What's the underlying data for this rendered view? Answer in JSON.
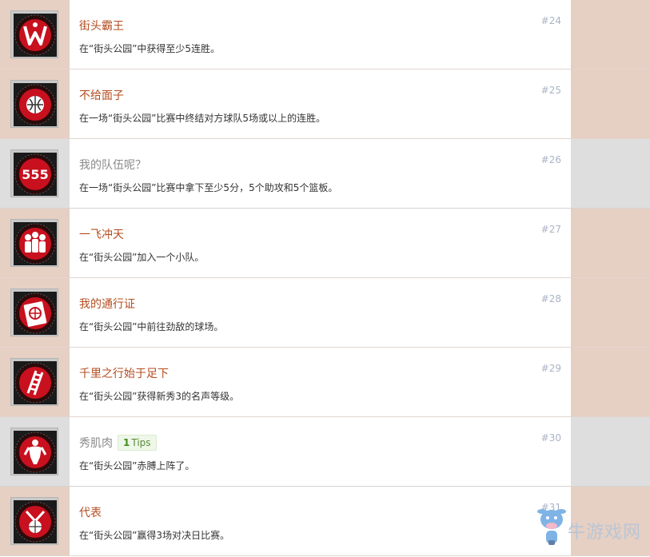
{
  "achievements": [
    {
      "title": "街头霸王",
      "description": "在“街头公园”中获得至少5连胜。",
      "number": "#24",
      "state": "unlocked",
      "icon": "wrestler-w-icon"
    },
    {
      "title": "不给面子",
      "description": "在一场“街头公园”比赛中终结对方球队5场或以上的连胜。",
      "number": "#25",
      "state": "unlocked",
      "icon": "broken-ball-icon"
    },
    {
      "title": "我的队伍呢？",
      "description": "在一场“街头公园”比赛中拿下至少5分，5个助攻和5个篮板。",
      "number": "#26",
      "state": "locked",
      "icon": "triple-five-icon"
    },
    {
      "title": "一飞冲天",
      "description": "在“街头公园”加入一个小队。",
      "number": "#27",
      "state": "unlocked",
      "icon": "three-players-icon"
    },
    {
      "title": "我的通行证",
      "description": "在“街头公园”中前往劲敌的球场。",
      "number": "#28",
      "state": "unlocked",
      "icon": "globe-pass-icon"
    },
    {
      "title": "千里之行始于足下",
      "description": "在“街头公园”获得新秀3的名声等级。",
      "number": "#29",
      "state": "unlocked",
      "icon": "ladder-icon"
    },
    {
      "title": "秀肌肉",
      "description": "在“街头公园”赤膊上阵了。",
      "number": "#30",
      "state": "locked",
      "icon": "muscle-man-icon",
      "tips": {
        "count": "1",
        "label": "Tips"
      }
    },
    {
      "title": "代表",
      "description": "在“街头公园”赢得3场对决日比赛。",
      "number": "#31",
      "state": "unlocked",
      "icon": "ball-trophy-icon"
    }
  ],
  "watermark": {
    "text": "牛游戏网",
    "icon": "cow-mascot-icon"
  },
  "colors": {
    "title_unlocked": "#b34d1f",
    "title_locked": "#8a8a8a",
    "side_unlocked": "#e6cfc3",
    "side_locked": "#dedede",
    "badge_red": "#c8101e",
    "number": "#a9b4c6"
  }
}
